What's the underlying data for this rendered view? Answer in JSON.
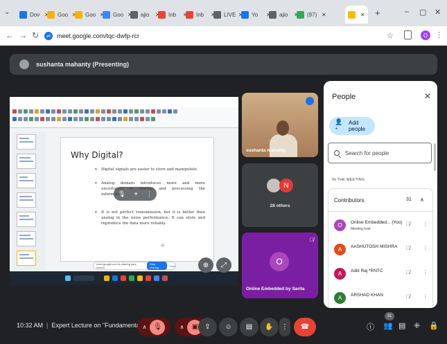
{
  "browser": {
    "tabs": [
      {
        "label": "Dov",
        "color": "#1a73e8"
      },
      {
        "label": "Goo",
        "color": "#f4b400"
      },
      {
        "label": "Goo",
        "color": "#f4b400"
      },
      {
        "label": "Goo",
        "color": "#4285f4"
      },
      {
        "label": "ajio",
        "color": "#5f6368"
      },
      {
        "label": "Inb",
        "color": "#ea4335"
      },
      {
        "label": "Inb",
        "color": "#ea4335"
      },
      {
        "label": "LIVE",
        "color": "#5f6368"
      },
      {
        "label": "Yo",
        "color": "#1a73e8"
      },
      {
        "label": "ajio",
        "color": "#5f6368"
      },
      {
        "label": "(97)",
        "color": "#34a853"
      }
    ],
    "active_tab_color": "#fbbc04",
    "url": "meet.google.com/tqc-dwfp-rcr",
    "profile_initial": "O"
  },
  "presenter": {
    "text": "sushanta mahanty (Presenting)"
  },
  "slide": {
    "title": "Why Digital?",
    "bullets": [
      "Digital signals are easier to store and manipulate.",
      "Analog domain introduces more and more uncertainty in storing and processing the information.",
      "It is not perfect transmission, but it is better than analog in the noise performance. It can store and reproduce the data more reliably."
    ],
    "share_text": "meet.google.com is sharing your screen.",
    "stop_label": "Stop sharing",
    "hide_label": "Hide"
  },
  "tiles": {
    "speaker_name": "sushanta mahanty",
    "others_count_label": "28 others",
    "others_initial": "N",
    "online_initial": "O",
    "online_name": "Online Embedded by Sarita"
  },
  "people_panel": {
    "title": "People",
    "add_label": "Add people",
    "search_placeholder": "Search for people",
    "section_label": "IN THE MEETING",
    "contributors_label": "Contributors",
    "contributors_count": "31",
    "participants": [
      {
        "initial": "O",
        "name": "Online Embedded... (You)",
        "sub": "Meeting host",
        "color": "#ab47bc"
      },
      {
        "initial": "A",
        "name": "AASHUTOSH MISHRA",
        "sub": "",
        "color": "#e64a19"
      },
      {
        "initial": "A",
        "name": "Aditi Raj *RNTC",
        "sub": "",
        "color": "#c2185b"
      },
      {
        "initial": "A",
        "name": "ARSHAD KHAN",
        "sub": "",
        "color": "#2e7d32"
      }
    ]
  },
  "bottom": {
    "time": "10:32 AM",
    "meeting_title": "Expert Lecture on \"Fundamental ...",
    "people_badge": "31"
  }
}
